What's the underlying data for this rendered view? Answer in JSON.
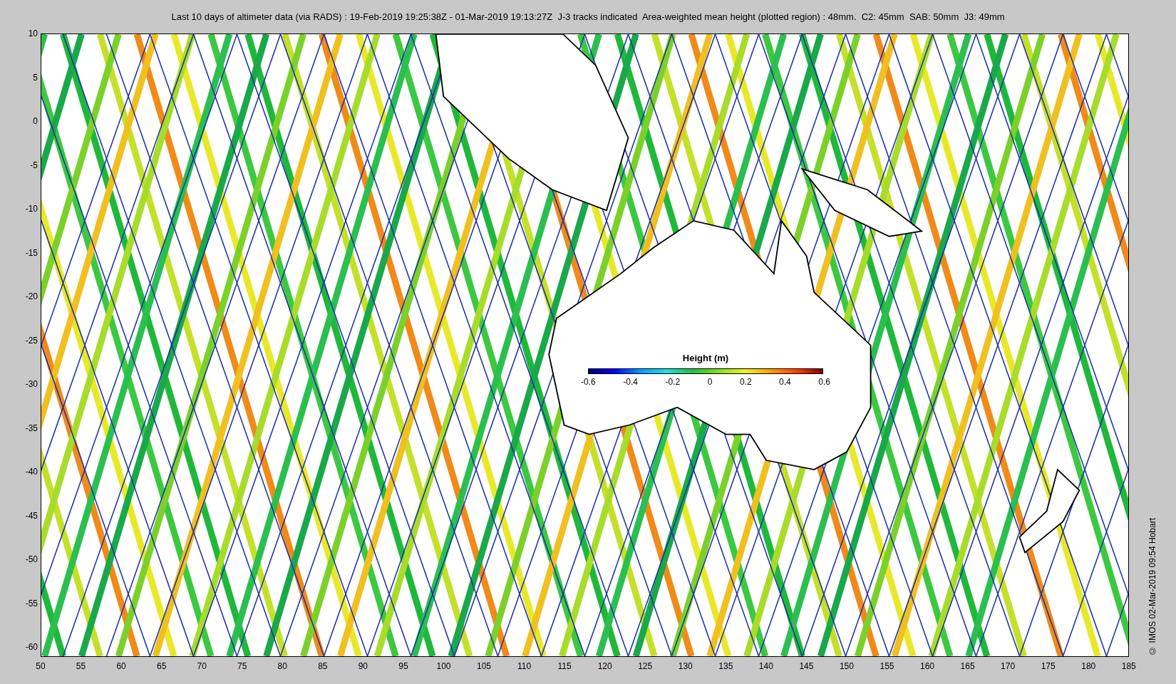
{
  "title": "Last 10 days of altimeter data (via RADS) : 19-Feb-2019 19:25:38Z - 01-Mar-2019 19:13:27Z  J-3 tracks indicated  Area-weighted mean height (plotted region) : 48mm.  C2: 45mm  SAB: 50mm  J3: 49mm",
  "y_ticks": [
    "10",
    "5",
    "0",
    "-5",
    "-10",
    "-15",
    "-20",
    "-25",
    "-30",
    "-35",
    "-40",
    "-45",
    "-50",
    "-55",
    "-60"
  ],
  "x_ticks": [
    "50",
    "55",
    "60",
    "65",
    "70",
    "75",
    "80",
    "85",
    "90",
    "95",
    "100",
    "105",
    "110",
    "115",
    "120",
    "125",
    "130",
    "135",
    "140",
    "145",
    "150",
    "155",
    "160",
    "165",
    "170",
    "175",
    "180",
    "185"
  ],
  "legend": {
    "title": "Height (m)",
    "ticks": [
      "-0.6",
      "-0.4",
      "-0.2",
      "0",
      "0.2",
      "0.4",
      "0.6"
    ]
  },
  "credit": "© IMOS 02-Mar-2019 09:54 Hobart"
}
